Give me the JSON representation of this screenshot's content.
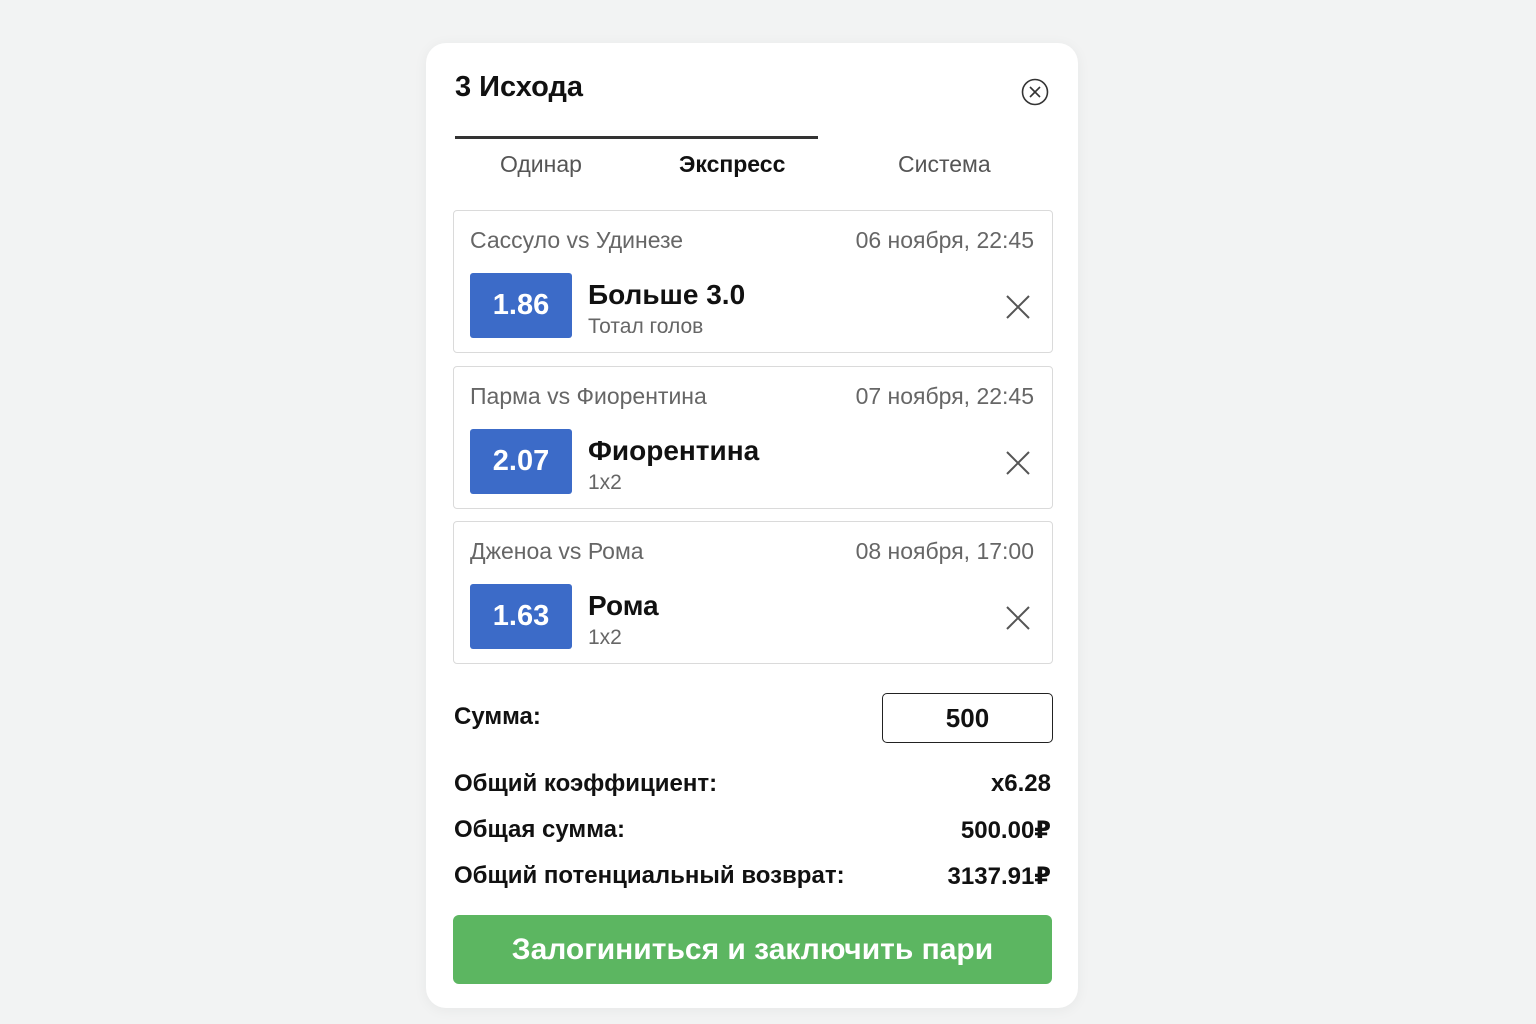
{
  "betslip": {
    "title": "3 Исхода",
    "tabs": [
      {
        "label": "Одинар",
        "active": false
      },
      {
        "label": "Экспресс",
        "active": true
      },
      {
        "label": "Система",
        "active": false
      }
    ],
    "bets": [
      {
        "match": "Сассуло vs Удинезе",
        "date": "06 ноября, 22:45",
        "odds": "1.86",
        "selection": "Больше 3.0",
        "market": "Тотал голов"
      },
      {
        "match": "Парма vs Фиорентина",
        "date": "07 ноября, 22:45",
        "odds": "2.07",
        "selection": "Фиорентина",
        "market": "1x2"
      },
      {
        "match": "Дженоа vs Рома",
        "date": "08 ноября, 17:00",
        "odds": "1.63",
        "selection": "Рома",
        "market": "1x2"
      }
    ],
    "stake": {
      "label": "Сумма:",
      "value": "500"
    },
    "summary": [
      {
        "label": "Общий коэффициент:",
        "value": "x6.28"
      },
      {
        "label": "Общая сумма:",
        "value": "500.00₽"
      },
      {
        "label": "Общий потенциальный возврат:",
        "value": "3137.91₽"
      }
    ],
    "submit_label": "Залогиниться и заключить пари"
  },
  "colors": {
    "odds_bg": "#3c6bc8",
    "submit_bg": "#5cb661",
    "page_bg": "#f2f3f3"
  },
  "icons": {
    "close": "close-circle-icon",
    "remove": "x-icon"
  }
}
